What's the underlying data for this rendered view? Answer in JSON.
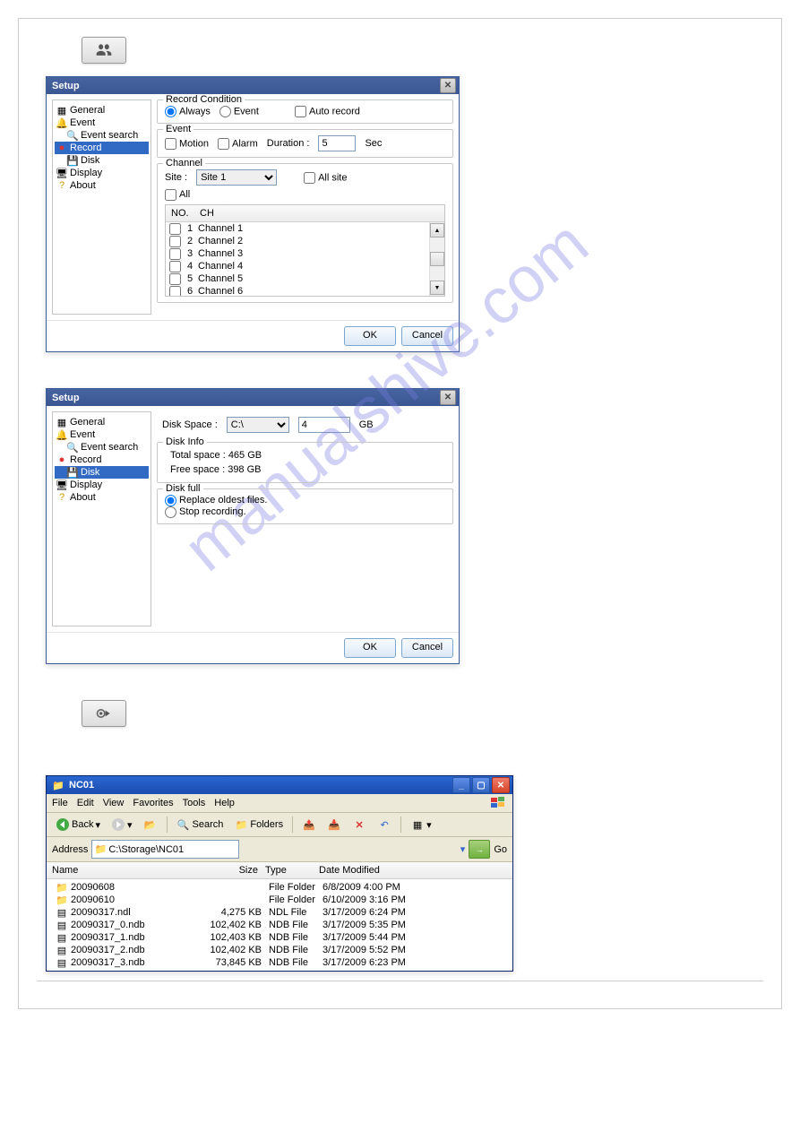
{
  "watermark": "manualshive.com",
  "btn_ok": "OK",
  "btn_cancel": "Cancel",
  "dialog1": {
    "title": "Setup",
    "tree": {
      "general": "General",
      "event": "Event",
      "event_search": "Event search",
      "record": "Record",
      "disk": "Disk",
      "display": "Display",
      "about": "About"
    },
    "record_condition": {
      "legend": "Record Condition",
      "always": "Always",
      "event": "Event",
      "auto": "Auto record"
    },
    "event": {
      "legend": "Event",
      "motion": "Motion",
      "alarm": "Alarm",
      "duration_label": "Duration :",
      "duration_value": "5",
      "sec": "Sec"
    },
    "channel": {
      "legend": "Channel",
      "site_label": "Site :",
      "site_value": "Site 1",
      "all_site": "All site",
      "all": "All",
      "col_no": "NO.",
      "col_ch": "CH",
      "rows": [
        {
          "no": "1",
          "ch": "Channel 1"
        },
        {
          "no": "2",
          "ch": "Channel 2"
        },
        {
          "no": "3",
          "ch": "Channel 3"
        },
        {
          "no": "4",
          "ch": "Channel 4"
        },
        {
          "no": "5",
          "ch": "Channel 5"
        },
        {
          "no": "6",
          "ch": "Channel 6"
        }
      ]
    }
  },
  "dialog2": {
    "title": "Setup",
    "disk_space_label": "Disk Space :",
    "drive": "C:\\",
    "size_value": "4",
    "size_unit": "GB",
    "disk_info": {
      "legend": "Disk Info",
      "total": "Total space : 465 GB",
      "free": "Free space : 398 GB"
    },
    "disk_full": {
      "legend": "Disk full",
      "replace": "Replace oldest files.",
      "stop": "Stop recording."
    }
  },
  "explorer": {
    "title": "NC01",
    "menus": {
      "file": "File",
      "edit": "Edit",
      "view": "View",
      "favorites": "Favorites",
      "tools": "Tools",
      "help": "Help"
    },
    "toolbar": {
      "back": "Back",
      "search": "Search",
      "folders": "Folders"
    },
    "address_label": "Address",
    "address_value": "C:\\Storage\\NC01",
    "go": "Go",
    "cols": {
      "name": "Name",
      "size": "Size",
      "type": "Type",
      "date": "Date Modified"
    },
    "files": [
      {
        "icon": "folder",
        "name": "20090608",
        "size": "",
        "type": "File Folder",
        "date": "6/8/2009 4:00 PM"
      },
      {
        "icon": "folder",
        "name": "20090610",
        "size": "",
        "type": "File Folder",
        "date": "6/10/2009 3:16 PM"
      },
      {
        "icon": "file",
        "name": "20090317.ndl",
        "size": "4,275 KB",
        "type": "NDL File",
        "date": "3/17/2009 6:24 PM"
      },
      {
        "icon": "file",
        "name": "20090317_0.ndb",
        "size": "102,402 KB",
        "type": "NDB File",
        "date": "3/17/2009 5:35 PM"
      },
      {
        "icon": "file",
        "name": "20090317_1.ndb",
        "size": "102,403 KB",
        "type": "NDB File",
        "date": "3/17/2009 5:44 PM"
      },
      {
        "icon": "file",
        "name": "20090317_2.ndb",
        "size": "102,402 KB",
        "type": "NDB File",
        "date": "3/17/2009 5:52 PM"
      },
      {
        "icon": "file",
        "name": "20090317_3.ndb",
        "size": "73,845 KB",
        "type": "NDB File",
        "date": "3/17/2009 6:23 PM"
      }
    ]
  }
}
